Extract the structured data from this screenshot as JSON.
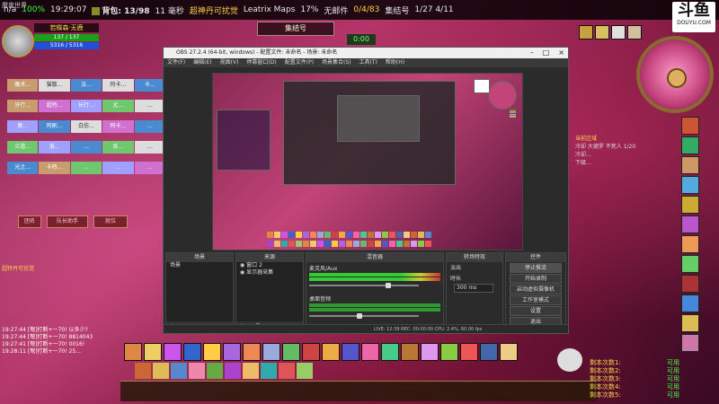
{
  "site": {
    "name": "魔兽世界"
  },
  "topbar": {
    "items": [
      "n/a",
      "100%",
      "19:29:07",
      "背包: 13/98",
      "11 毫秒",
      "超神丹可扰觉",
      "Leatrix Maps",
      "17%",
      "无邮件",
      "0/4/83",
      "集结号",
      "1/27 4/11"
    ]
  },
  "douyu": {
    "logo": "斗鱼",
    "url": "DOUYU.COM"
  },
  "player": {
    "name": "若蝶森·无鹿",
    "hp": "137 / 137",
    "mp": "5316 / 5316"
  },
  "target": {
    "name": "集结号"
  },
  "timer": {
    "value": "0:00"
  },
  "raid": {
    "rows": [
      [
        "魔术…",
        "猫散…",
        "法…",
        "阿卡…",
        "卡…"
      ],
      [
        "牙行…",
        "超特…",
        "长行…",
        "尤…",
        "…"
      ],
      [
        "奥…",
        "阿刷…",
        "白仿…",
        "阿卡…",
        "…"
      ],
      [
        "兰道…",
        "洛…",
        "…",
        "肯…",
        "…"
      ],
      [
        "光之…",
        "卡特…",
        "…",
        "…",
        "…"
      ]
    ],
    "buttons": [
      "团名",
      "队长助手",
      "就位"
    ]
  },
  "chat": {
    "title": "超特丹可扰觉",
    "lines": [
      "19:27:44 [弩]打断+一70! 以多少?",
      "19:27:44 [弩]打断+一70! 8814043",
      "19:27:41 [弩]打断+一70! 0016!",
      "19:28:11 [弩]打断+一70! 25…"
    ]
  },
  "quest": {
    "lines": [
      "当前区域",
      "冷却 大德罗 不死人 1/20",
      "冷却…",
      "下级…"
    ]
  },
  "damage": {
    "rows": [
      {
        "label": "剩本次数1:",
        "value": "可用"
      },
      {
        "label": "剩本次数2:",
        "value": "可用"
      },
      {
        "label": "剩本次数3:",
        "value": "可用"
      },
      {
        "label": "剩本次数4:",
        "value": "可用"
      },
      {
        "label": "剩本次数5:",
        "value": "可用"
      }
    ]
  },
  "obs": {
    "title": "OBS 27.2.4 (64-bit, windows) - 配置文件: 未命名 - 场景: 未命名",
    "menu": [
      "文件(F)",
      "编辑(E)",
      "视图(V)",
      "停靠窗口(D)",
      "配置文件(P)",
      "场景集合(S)",
      "工具(T)",
      "帮助(H)"
    ],
    "docks": {
      "scenes": {
        "title": "场景",
        "items": [
          "场景"
        ]
      },
      "sources": {
        "title": "来源",
        "items": [
          "窗口 2",
          "显示器采集"
        ]
      },
      "mixer": {
        "title": "混音器",
        "channels": [
          {
            "name": "麦克风/Aux",
            "level": 0.72
          },
          {
            "name": "桌面音频",
            "level": 0.45
          }
        ]
      },
      "transitions": {
        "title": "转场特效",
        "type_label": "淡出",
        "duration_label": "时长",
        "duration": "300 ms"
      },
      "controls": {
        "title": "控件",
        "buttons": [
          "停止推流",
          "开始录制",
          "启动虚拟摄像机",
          "工作室模式",
          "设置",
          "退出"
        ]
      }
    },
    "status": "LIVE: 12:39   REC: 00:00:00   CPU: 2.4%, 60.00 fps"
  },
  "colors": {
    "accent": "#ffd34a",
    "hp": "#19a019",
    "mp": "#2050d8",
    "ok": "#44ff44"
  }
}
